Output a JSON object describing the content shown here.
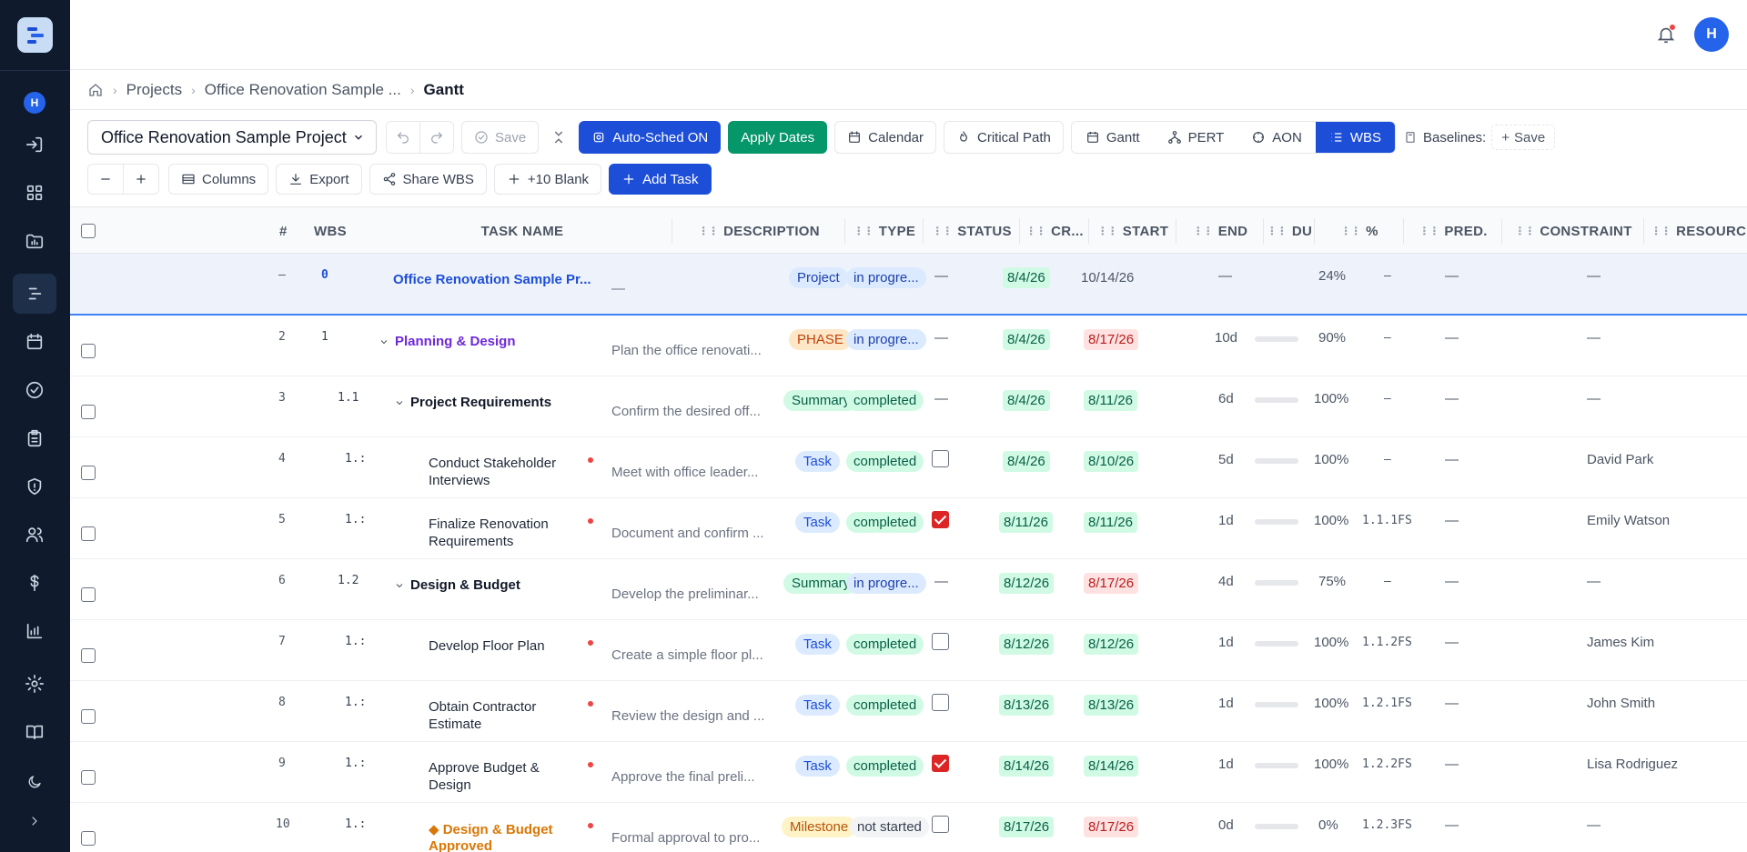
{
  "sidebar": {
    "avatar_initial": "H",
    "items": [
      {
        "icon": "logout-icon"
      },
      {
        "icon": "dashboard-icon"
      },
      {
        "icon": "folder-chart-icon"
      },
      {
        "icon": "gantt-icon",
        "active": true
      },
      {
        "icon": "calendar-icon"
      },
      {
        "icon": "check-circle-icon"
      },
      {
        "icon": "clipboard-icon"
      },
      {
        "icon": "shield-icon"
      },
      {
        "icon": "users-icon"
      },
      {
        "icon": "dollar-icon"
      },
      {
        "icon": "bar-chart-icon"
      },
      {
        "icon": "gear-icon"
      },
      {
        "icon": "book-icon"
      },
      {
        "icon": "moon-icon"
      },
      {
        "icon": "chevron-right-icon"
      }
    ]
  },
  "topbar": {
    "user_initial": "H"
  },
  "breadcrumb": {
    "items": [
      "Projects",
      "Office Renovation Sample ..."
    ],
    "current": "Gantt"
  },
  "toolbar": {
    "project_select": "Office Renovation Sample Project",
    "save_label": "Save",
    "auto_sched_label": "Auto-Sched ON",
    "apply_dates_label": "Apply Dates",
    "calendar_label": "Calendar",
    "critical_path_label": "Critical Path",
    "views": [
      "Gantt",
      "PERT",
      "AON",
      "WBS"
    ],
    "active_view": "WBS",
    "baselines_label": "Baselines:",
    "baseline_save_label": "Save",
    "columns_label": "Columns",
    "export_label": "Export",
    "share_label": "Share WBS",
    "blank_label": "+10 Blank",
    "add_task_label": "Add Task"
  },
  "table": {
    "headers": {
      "num": "#",
      "wbs": "WBS",
      "name": "TASK NAME",
      "description": "DESCRIPTION",
      "type": "TYPE",
      "status": "STATUS",
      "critical": "CR...",
      "start": "START",
      "end": "END",
      "duration": "DU",
      "percent": "%",
      "pred": "PRED.",
      "constraint": "CONSTRAINT",
      "resources": "RESOURCES"
    },
    "rows": [
      {
        "num": "—",
        "wbs": "0",
        "name": "Office Renovation Sample Pr...",
        "desc": "—",
        "type": "Project",
        "status": "in progre...",
        "crit": "—",
        "start": "8/4/26",
        "end": "10/14/26",
        "dur": "—",
        "pct": "24%",
        "progress": 0.24,
        "pred": "–",
        "constraint": "—",
        "resources": "—"
      },
      {
        "num": "2",
        "wbs": "1",
        "name": "Planning & Design",
        "desc": "Plan the office renovati...",
        "type": "PHASE",
        "status": "in progre...",
        "crit": "—",
        "start": "8/4/26",
        "end": "8/17/26",
        "dur": "10d",
        "pct": "90%",
        "progress": 0.9,
        "pred": "–",
        "constraint": "—",
        "resources": "—"
      },
      {
        "num": "3",
        "wbs": "1.1",
        "name": "Project Requirements",
        "desc": "Confirm the desired off...",
        "type": "Summary",
        "status": "completed",
        "crit": "—",
        "start": "8/4/26",
        "end": "8/11/26",
        "dur": "6d",
        "pct": "100%",
        "progress": 1.0,
        "pred": "–",
        "constraint": "—",
        "resources": "—"
      },
      {
        "num": "4",
        "wbs": "1.:",
        "name": "Conduct Stakeholder",
        "name2": "Interviews",
        "desc": "Meet with office leader...",
        "type": "Task",
        "status": "completed",
        "crit": false,
        "start": "8/4/26",
        "end": "8/10/26",
        "dur": "5d",
        "pct": "100%",
        "progress": 1.0,
        "pred": "–",
        "constraint": "—",
        "resources": "David Park"
      },
      {
        "num": "5",
        "wbs": "1.:",
        "name": "Finalize Renovation",
        "name2": "Requirements",
        "desc": "Document and confirm ...",
        "type": "Task",
        "status": "completed",
        "crit": true,
        "start": "8/11/26",
        "end": "8/11/26",
        "dur": "1d",
        "pct": "100%",
        "progress": 1.0,
        "pred": "1.1.1FS",
        "constraint": "—",
        "resources": "Emily Watson"
      },
      {
        "num": "6",
        "wbs": "1.2",
        "name": "Design & Budget",
        "desc": "Develop the preliminar...",
        "type": "Summary",
        "status": "in progre...",
        "crit": "—",
        "start": "8/12/26",
        "end": "8/17/26",
        "dur": "4d",
        "pct": "75%",
        "progress": 0.75,
        "pred": "–",
        "constraint": "—",
        "resources": "—"
      },
      {
        "num": "7",
        "wbs": "1.:",
        "name": "Develop Floor Plan",
        "desc": "Create a simple floor pl...",
        "type": "Task",
        "status": "completed",
        "crit": false,
        "start": "8/12/26",
        "end": "8/12/26",
        "dur": "1d",
        "pct": "100%",
        "progress": 1.0,
        "pred": "1.1.2FS",
        "constraint": "—",
        "resources": "James Kim"
      },
      {
        "num": "8",
        "wbs": "1.:",
        "name": "Obtain Contractor",
        "name2": "Estimate",
        "desc": "Review the design and ...",
        "type": "Task",
        "status": "completed",
        "crit": false,
        "start": "8/13/26",
        "end": "8/13/26",
        "dur": "1d",
        "pct": "100%",
        "progress": 1.0,
        "pred": "1.2.1FS",
        "constraint": "—",
        "resources": "John Smith"
      },
      {
        "num": "9",
        "wbs": "1.:",
        "name": "Approve Budget &",
        "name2": "Design",
        "desc": "Approve the final preli...",
        "type": "Task",
        "status": "completed",
        "crit": true,
        "start": "8/14/26",
        "end": "8/14/26",
        "dur": "1d",
        "pct": "100%",
        "progress": 1.0,
        "pred": "1.2.2FS",
        "constraint": "—",
        "resources": "Lisa Rodriguez"
      },
      {
        "num": "10",
        "wbs": "1.:",
        "name": "◆ Design & Budget",
        "name2": "Approved",
        "desc": "Formal approval to pro...",
        "type": "Milestone",
        "status": "not started",
        "crit": false,
        "start": "8/17/26",
        "end": "8/17/26",
        "dur": "0d",
        "pct": "0%",
        "progress": 0.0,
        "pred": "1.2.3FS",
        "constraint": "—",
        "resources": "—"
      }
    ]
  }
}
